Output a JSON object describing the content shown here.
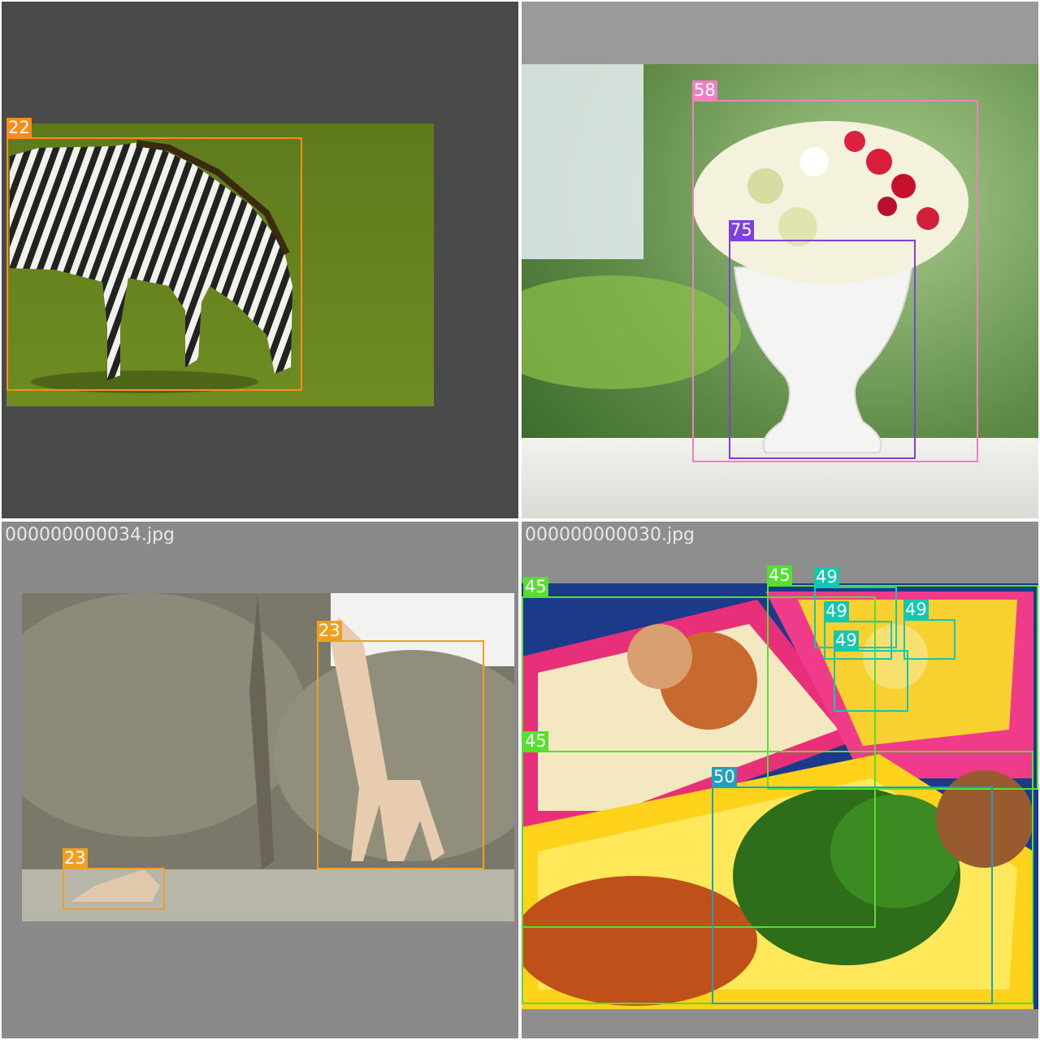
{
  "tiles": [
    {
      "filename": "",
      "boxes": [
        {
          "label": "22",
          "color": "#ff8c1a"
        }
      ]
    },
    {
      "filename": "",
      "boxes": [
        {
          "label": "58",
          "color": "#f080c0"
        },
        {
          "label": "75",
          "color": "#7b3fe4"
        }
      ]
    },
    {
      "filename": "000000000034.jpg",
      "boxes": [
        {
          "label": "23",
          "color": "#f0a020"
        },
        {
          "label": "23",
          "color": "#f0a020"
        }
      ]
    },
    {
      "filename": "000000000030.jpg",
      "boxes": [
        {
          "label": "45",
          "color": "#55e030"
        },
        {
          "label": "45",
          "color": "#55e030"
        },
        {
          "label": "45",
          "color": "#55e030"
        },
        {
          "label": "49",
          "color": "#14c8b0"
        },
        {
          "label": "49",
          "color": "#14c8b0"
        },
        {
          "label": "49",
          "color": "#14c8b0"
        },
        {
          "label": "49",
          "color": "#14c8b0"
        },
        {
          "label": "50",
          "color": "#20a0c0"
        }
      ]
    }
  ]
}
